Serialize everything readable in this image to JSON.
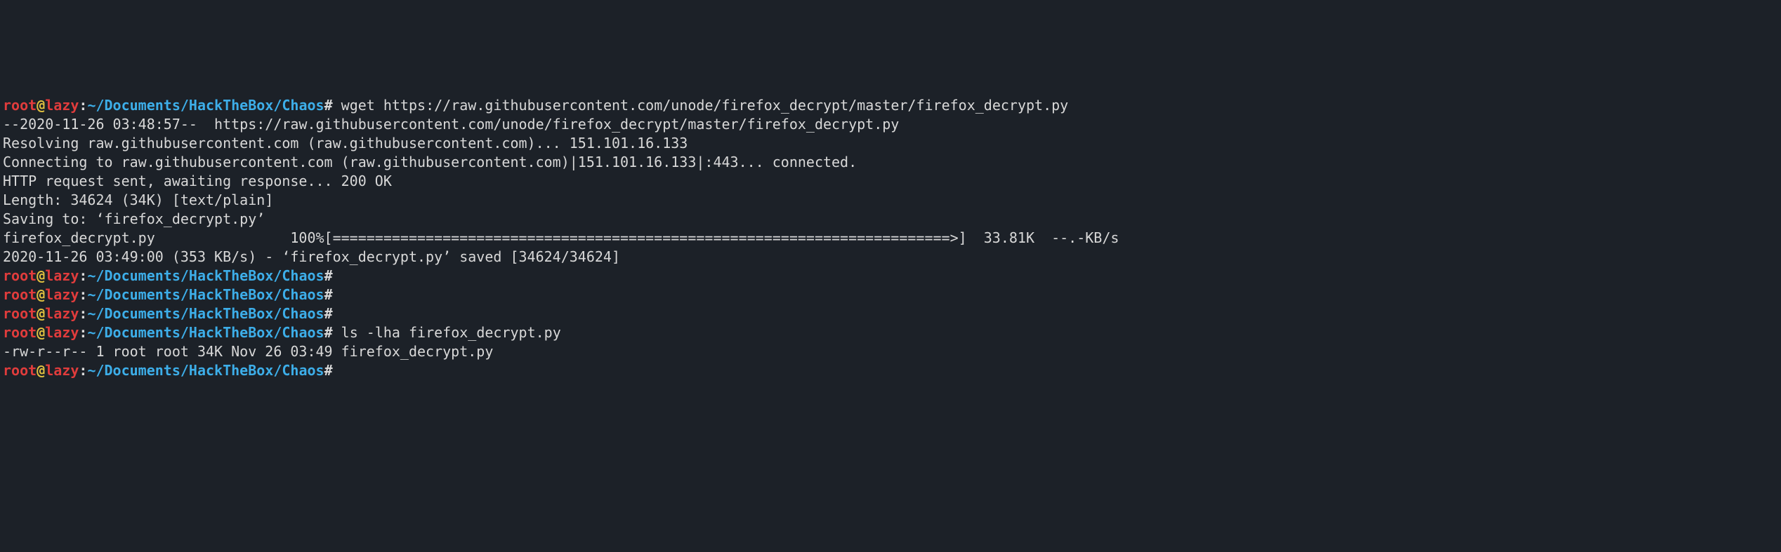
{
  "prompt": {
    "user": "root",
    "at": "@",
    "host": "lazy",
    "colon": ":",
    "path": "~/Documents/HackTheBox/Chaos",
    "hash": "#"
  },
  "lines": [
    {
      "type": "prompt",
      "cmd": " wget https://raw.githubusercontent.com/unode/firefox_decrypt/master/firefox_decrypt.py"
    },
    {
      "type": "out",
      "text": "--2020-11-26 03:48:57--  https://raw.githubusercontent.com/unode/firefox_decrypt/master/firefox_decrypt.py"
    },
    {
      "type": "out",
      "text": "Resolving raw.githubusercontent.com (raw.githubusercontent.com)... 151.101.16.133"
    },
    {
      "type": "out",
      "text": "Connecting to raw.githubusercontent.com (raw.githubusercontent.com)|151.101.16.133|:443... connected."
    },
    {
      "type": "out",
      "text": "HTTP request sent, awaiting response... 200 OK"
    },
    {
      "type": "out",
      "text": "Length: 34624 (34K) [text/plain]"
    },
    {
      "type": "out",
      "text": "Saving to: ‘firefox_decrypt.py’"
    },
    {
      "type": "out",
      "text": ""
    },
    {
      "type": "out",
      "text": "firefox_decrypt.py                100%[=========================================================================>]  33.81K  --.-KB/s"
    },
    {
      "type": "out",
      "text": ""
    },
    {
      "type": "out",
      "text": "2020-11-26 03:49:00 (353 KB/s) - ‘firefox_decrypt.py’ saved [34624/34624]"
    },
    {
      "type": "out",
      "text": ""
    },
    {
      "type": "prompt",
      "cmd": ""
    },
    {
      "type": "prompt",
      "cmd": ""
    },
    {
      "type": "prompt",
      "cmd": ""
    },
    {
      "type": "prompt",
      "cmd": " ls -lha firefox_decrypt.py"
    },
    {
      "type": "out",
      "text": "-rw-r--r-- 1 root root 34K Nov 26 03:49 firefox_decrypt.py"
    },
    {
      "type": "prompt",
      "cmd": ""
    }
  ]
}
